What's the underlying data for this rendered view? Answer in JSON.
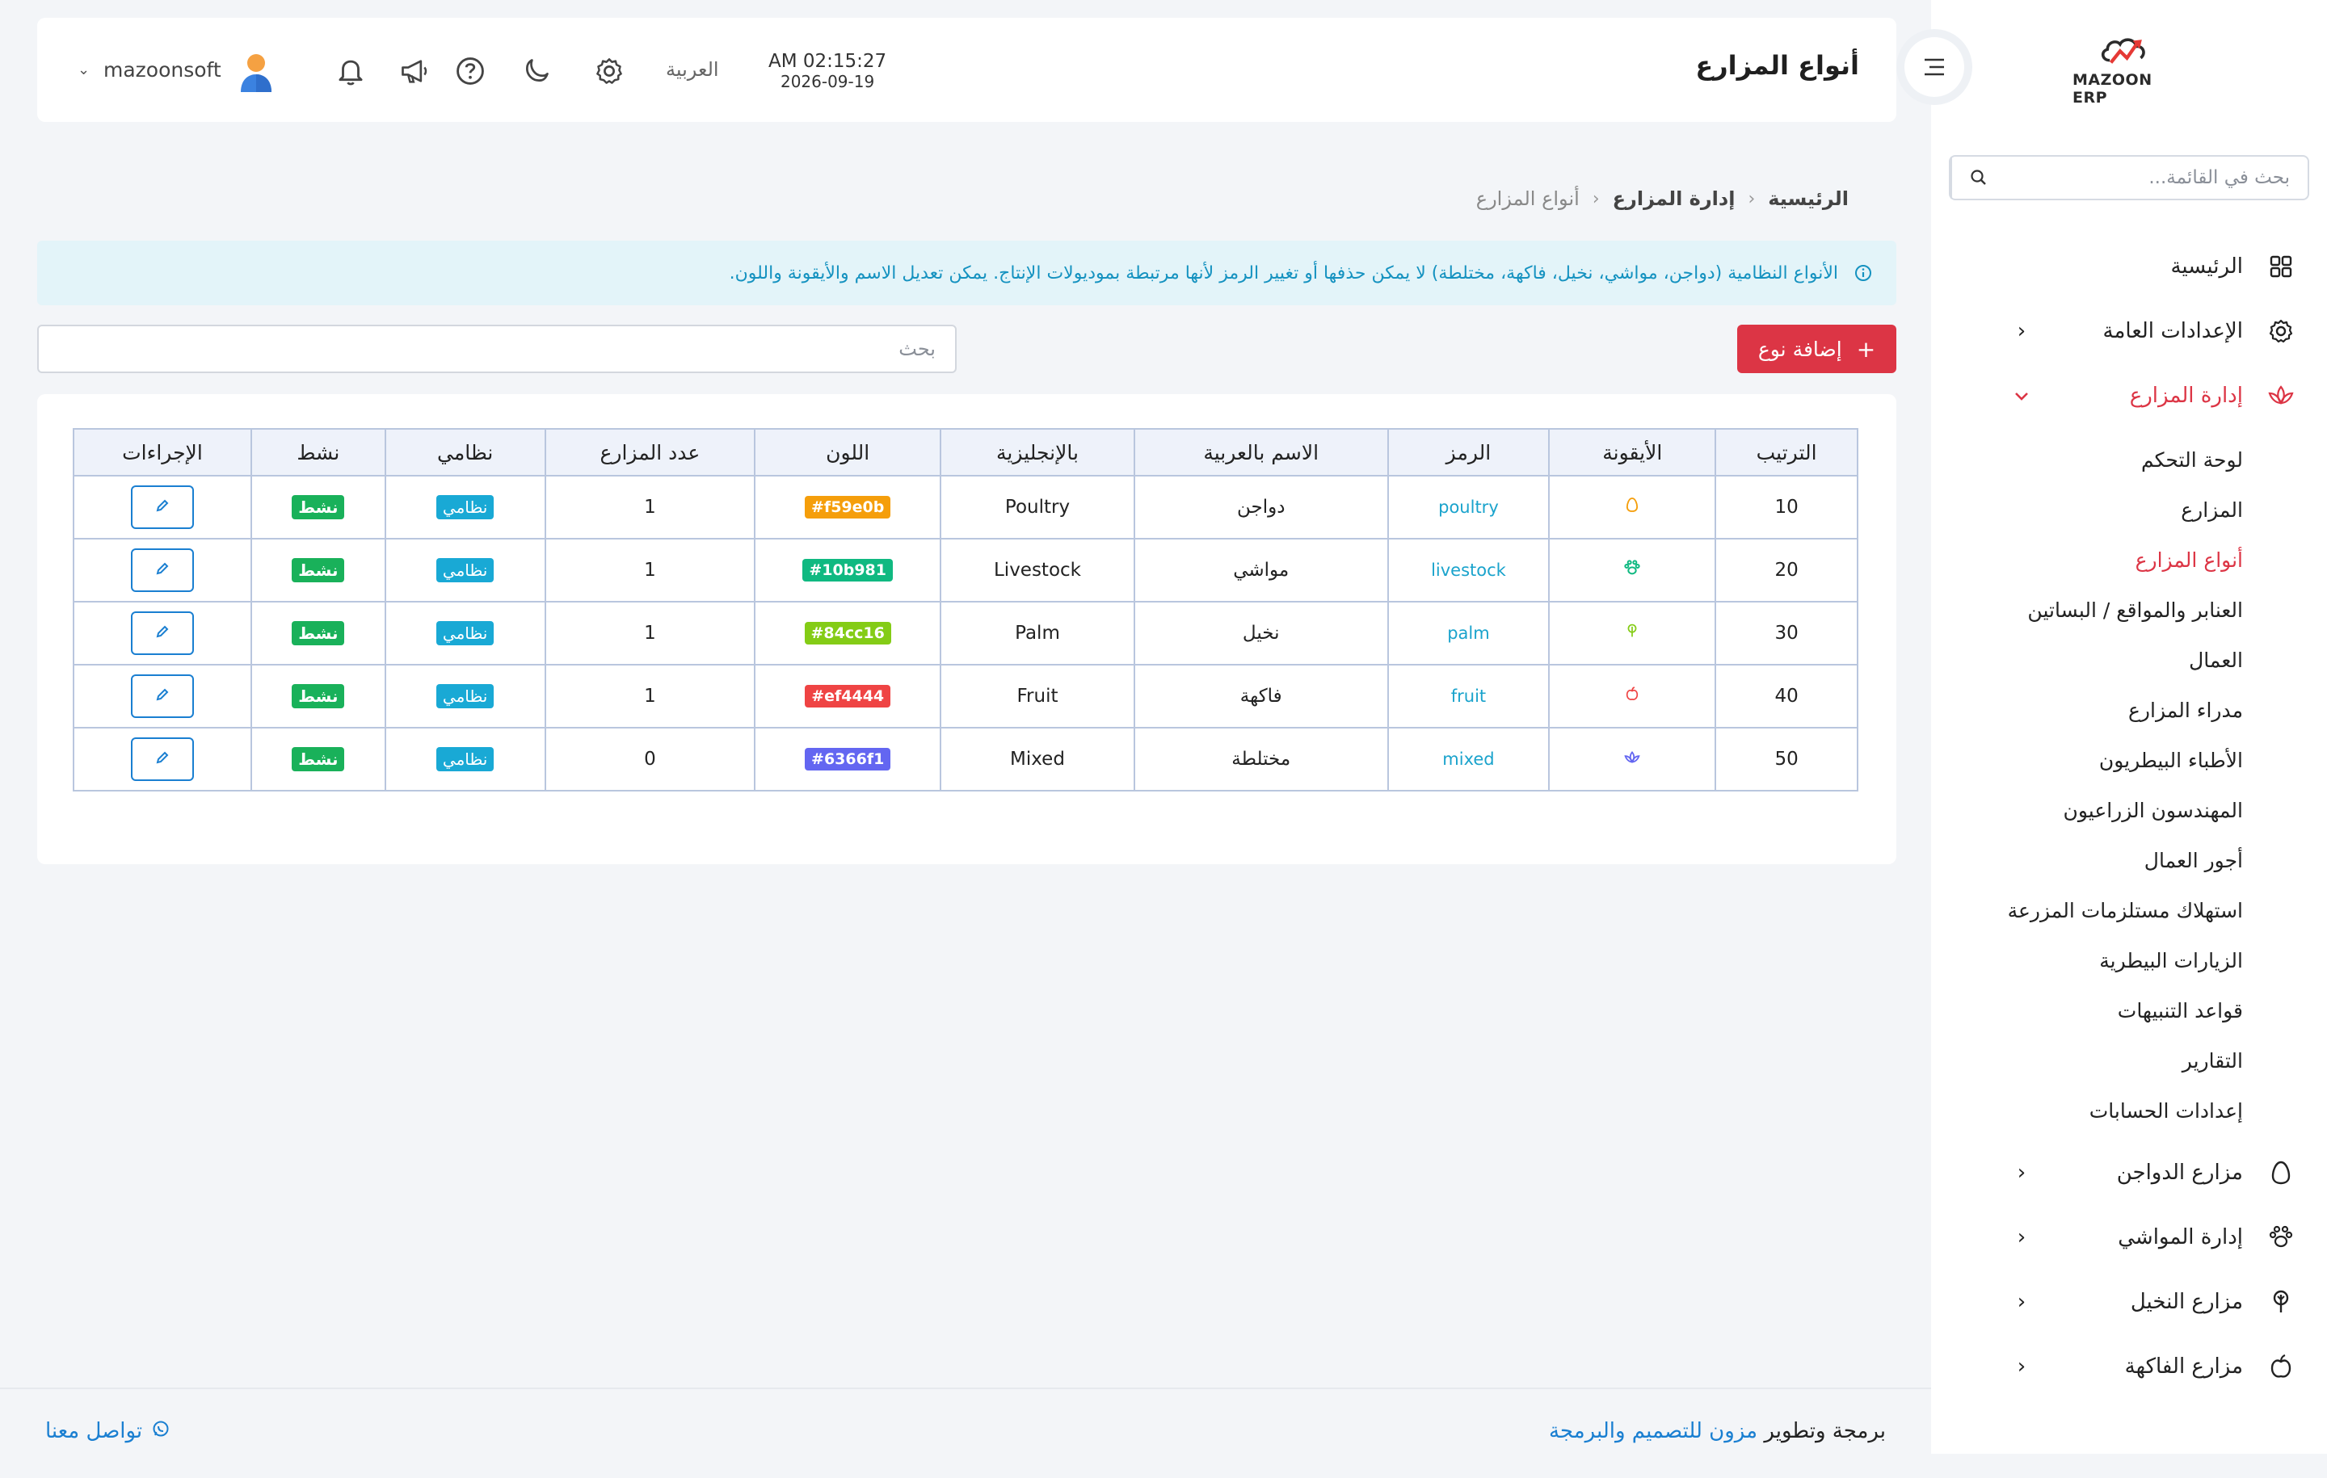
{
  "app": {
    "logo_text": "MAZOON ERP",
    "page_title": "أنواع المزارع"
  },
  "header": {
    "time": "AM 02:15:27",
    "date": "2026-09-19",
    "language": "العربية",
    "username": "mazoonsoft"
  },
  "sidebar": {
    "search_placeholder": "بحث في القائمة...",
    "items": [
      {
        "label": "الرئيسية",
        "icon": "grid-icon"
      },
      {
        "label": "الإعدادات العامة",
        "icon": "gear-icon"
      },
      {
        "label": "إدارة المزارع",
        "icon": "lotus-icon"
      },
      {
        "label": "مزارع الدواجن",
        "icon": "egg-icon"
      },
      {
        "label": "إدارة المواشي",
        "icon": "paw-icon"
      },
      {
        "label": "مزارع النخيل",
        "icon": "palm-icon"
      },
      {
        "label": "مزارع الفاكهة",
        "icon": "apple-icon"
      }
    ],
    "submenu": [
      "لوحة التحكم",
      "المزارع",
      "أنواع المزارع",
      "العنابر والمواقع / البساتين",
      "العمال",
      "مدراء المزارع",
      "الأطباء البيطريون",
      "المهندسون الزراعيون",
      "أجور العمال",
      "استهلاك مستلزمات المزرعة",
      "الزيارات البيطرية",
      "قواعد التنبيهات",
      "التقارير",
      "إعدادات الحسابات"
    ]
  },
  "breadcrumb": {
    "home": "الرئيسية",
    "section": "إدارة المزارع",
    "current": "أنواع المزارع"
  },
  "alert": {
    "text": "الأنواع النظامية (دواجن، مواشي، نخيل، فاكهة، مختلطة) لا يمكن حذفها أو تغيير الرمز لأنها مرتبطة بموديولات الإنتاج. يمكن تعديل الاسم والأيقونة واللون."
  },
  "toolbar": {
    "add_label": "إضافة نوع",
    "search_placeholder": "بحث"
  },
  "table": {
    "headers": {
      "order": "الترتيب",
      "icon": "الأيقونة",
      "code": "الرمز",
      "name_ar": "الاسم بالعربية",
      "name_en": "بالإنجليزية",
      "color": "اللون",
      "farms": "عدد المزارع",
      "system": "نظامي",
      "active": "نشط",
      "actions": "الإجراءات"
    },
    "rows": [
      {
        "order": "10",
        "icon": "egg-icon",
        "code": "poultry",
        "name_ar": "دواجن",
        "name_en": "Poultry",
        "color": "#f59e0b",
        "farms": "1",
        "system": "نظامي",
        "active": "نشط"
      },
      {
        "order": "20",
        "icon": "paw-icon",
        "code": "livestock",
        "name_ar": "مواشي",
        "name_en": "Livestock",
        "color": "#10b981",
        "farms": "1",
        "system": "نظامي",
        "active": "نشط"
      },
      {
        "order": "30",
        "icon": "palm-icon",
        "code": "palm",
        "name_ar": "نخيل",
        "name_en": "Palm",
        "color": "#84cc16",
        "farms": "1",
        "system": "نظامي",
        "active": "نشط"
      },
      {
        "order": "40",
        "icon": "apple-icon",
        "code": "fruit",
        "name_ar": "فاكهة",
        "name_en": "Fruit",
        "color": "#ef4444",
        "farms": "1",
        "system": "نظامي",
        "active": "نشط"
      },
      {
        "order": "50",
        "icon": "lotus-icon",
        "code": "mixed",
        "name_ar": "مختلطة",
        "name_en": "Mixed",
        "color": "#6366f1",
        "farms": "0",
        "system": "نظامي",
        "active": "نشط"
      }
    ]
  },
  "footer": {
    "credit_prefix": "برمجة وتطوير",
    "credit_brand": "مزون للتصميم والبرمجة",
    "contact": "تواصل معنا"
  },
  "colors": {
    "accent": "#dc3545",
    "link": "#1a7fd1",
    "info": "#1592c0",
    "success": "#19b15a",
    "system_badge": "#19a9d5"
  }
}
